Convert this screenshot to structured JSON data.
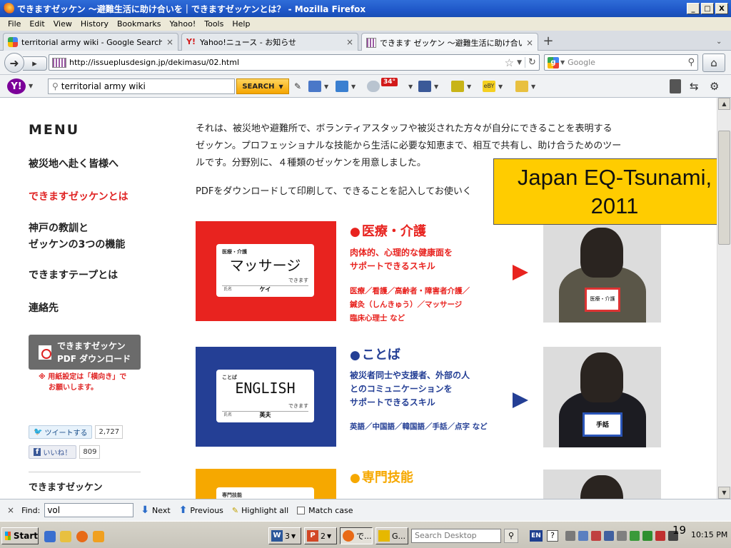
{
  "window": {
    "title": "できますゼッケン ～避難生活に助け合いを｜できますゼッケンとは？ - Mozilla Firefox",
    "controls": {
      "minimize": "_",
      "maximize": "□",
      "close": "X"
    }
  },
  "menubar": [
    "File",
    "Edit",
    "View",
    "History",
    "Bookmarks",
    "Yahoo!",
    "Tools",
    "Help"
  ],
  "tabs": [
    {
      "label": "territorial army wiki - Google Search",
      "close": "×",
      "favicon": "google-icon"
    },
    {
      "label": "Yahoo!ニュース - お知らせ",
      "close": "×",
      "favicon": "yahoo-icon"
    },
    {
      "label": "できます ゼッケン ～避難生活に助け合いを...",
      "close": "×",
      "favicon": "site-icon"
    }
  ],
  "new_tab": "+",
  "tab_list": "⌄",
  "nav": {
    "url": "http://issueplusdesign.jp/dekimasu/02.html",
    "search_engine": "Google",
    "search_placeholder": "Google"
  },
  "yahoo_toolbar": {
    "logo": "Y!",
    "search_value": "territorial army wiki",
    "search_button": "SEARCH",
    "weather_temp": "34°"
  },
  "page": {
    "menu_heading": "MENU",
    "nav_items": [
      "被災地へ赴く皆様へ",
      "できますゼッケンとは",
      "神戸の教訓と",
      "ゼッケンの3つの機能",
      "できますテープとは",
      "連絡先"
    ],
    "pdf_button_line1": "できますゼッケン",
    "pdf_button_line2": "PDF ダウンロード",
    "pdf_note_line1": "※ 用紙設定は「横向き」で",
    "pdf_note_line2": "お願いします。",
    "tweet_label": "ツイートする",
    "tweet_count": "2,727",
    "like_label": "いいね！",
    "like_count": "809",
    "bottom_nav": "できますゼッケン",
    "intro_lines": [
      "それは、被災地や避難所で、ボランティアスタッフや被災された方々が自分にできることを表明する",
      "ゼッケン。プロフェッショナルな技能から生活に必要な知恵まで、相互で共有し、助け合うためのツー",
      "ルです。分野別に、４種類のゼッケンを用意しました。"
    ],
    "intro2": "PDFをダウンロードして印刷して、できることを記入してお使いく",
    "cards": [
      {
        "title": "医療・介護",
        "color": "#e8231f",
        "tag_small": "医療・介護",
        "tag_big": "マッサージ",
        "tag_can": "できます",
        "tag_name_label": "氏名",
        "tag_name": "ケイ",
        "desc_lines": [
          "肉体的、心理的な健康面を",
          "サポートできるスキル"
        ],
        "skills_lines": [
          "医療／看護／高齢者・障害者介護／",
          "鍼灸（しんきゅう）／マッサージ",
          "臨床心理士 など"
        ]
      },
      {
        "title": "ことば",
        "color": "#243f95",
        "tag_small": "ことば",
        "tag_big": "ENGLISH",
        "tag_can": "できます",
        "tag_name_label": "氏名",
        "tag_name": "英夫",
        "desc_lines": [
          "被災者同士や支援者、外部の人",
          "とのコミュニケーションを",
          "サポートできるスキル"
        ],
        "skills_lines": [
          "英語／中国語／韓国語／手話／点字 など"
        ]
      },
      {
        "title": "専門技能",
        "color": "#f6a800",
        "tag_small": "専門技能",
        "tag_big": "",
        "tag_can": "",
        "tag_name_label": "",
        "tag_name": "",
        "desc_lines": [],
        "skills_lines": []
      }
    ],
    "photo_labels": [
      "医療・介護",
      "手話"
    ]
  },
  "callout": {
    "line1": "Japan EQ-Tsunami,",
    "line2": "2011"
  },
  "findbar": {
    "close": "×",
    "label": "Find:",
    "value": "vol",
    "next": "Next",
    "previous": "Previous",
    "highlight_all": "Highlight all",
    "match_case": "Match case"
  },
  "taskbar": {
    "start": "Start",
    "buttons": [
      {
        "icon": "W",
        "label": "3",
        "color": "#2b579a"
      },
      {
        "icon": "P",
        "label": "2",
        "color": "#d24726"
      },
      {
        "icon": "",
        "label": "で...",
        "color": "#e86a17"
      },
      {
        "icon": "",
        "label": "G...",
        "color": "#e6b800"
      }
    ],
    "desktop_search_placeholder": "Search Desktop",
    "language": "EN",
    "help": "?",
    "clock": "10:15 PM"
  },
  "slide_number": "19"
}
